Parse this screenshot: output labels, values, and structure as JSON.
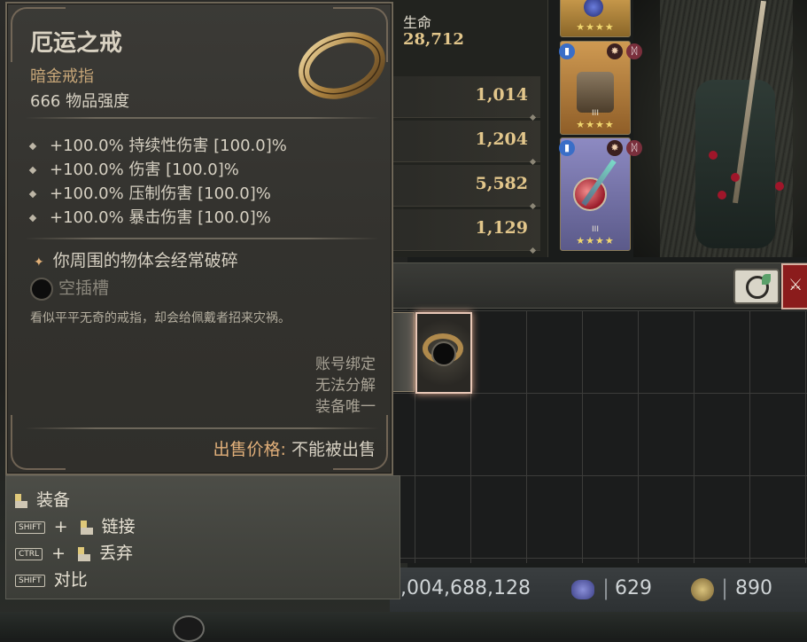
{
  "tooltip": {
    "item_name": "厄运之戒",
    "item_type": "暗金戒指",
    "item_power": "666 物品强度",
    "affixes": [
      "+100.0% 持续性伤害 [100.0]%",
      "+100.0% 伤害 [100.0]%",
      "+100.0% 压制伤害 [100.0]%",
      "+100.0% 暴击伤害 [100.0]%"
    ],
    "aspect": "你周围的物体会经常破碎",
    "socket": "空插槽",
    "flavor": "看似平平无奇的戒指，却会给佩戴者招来灾祸。",
    "tags": [
      "账号绑定",
      "无法分解",
      "装备唯一"
    ],
    "sell_label": "出售价格:",
    "sell_value": "不能被出售"
  },
  "hints": {
    "equip": "装备",
    "link": "链接",
    "discard": "丢弃",
    "compare": "对比",
    "shift_key": "SHIFT",
    "ctrl_key": "CTRL",
    "plus": "+"
  },
  "stats": {
    "life_label": "生命",
    "life_value": "28,712",
    "rows": [
      "1,014",
      "1,204",
      "5,582",
      "1,129"
    ]
  },
  "equipment": {
    "card_tier": "III",
    "stars": "★★★★"
  },
  "currency": {
    "gold": ",004,688,128",
    "obols": "629",
    "red_dust": "890"
  },
  "colors": {
    "gold_text": "#e2c68b",
    "unique_type": "#c7a678",
    "selected_border": "#e8c7b6"
  }
}
